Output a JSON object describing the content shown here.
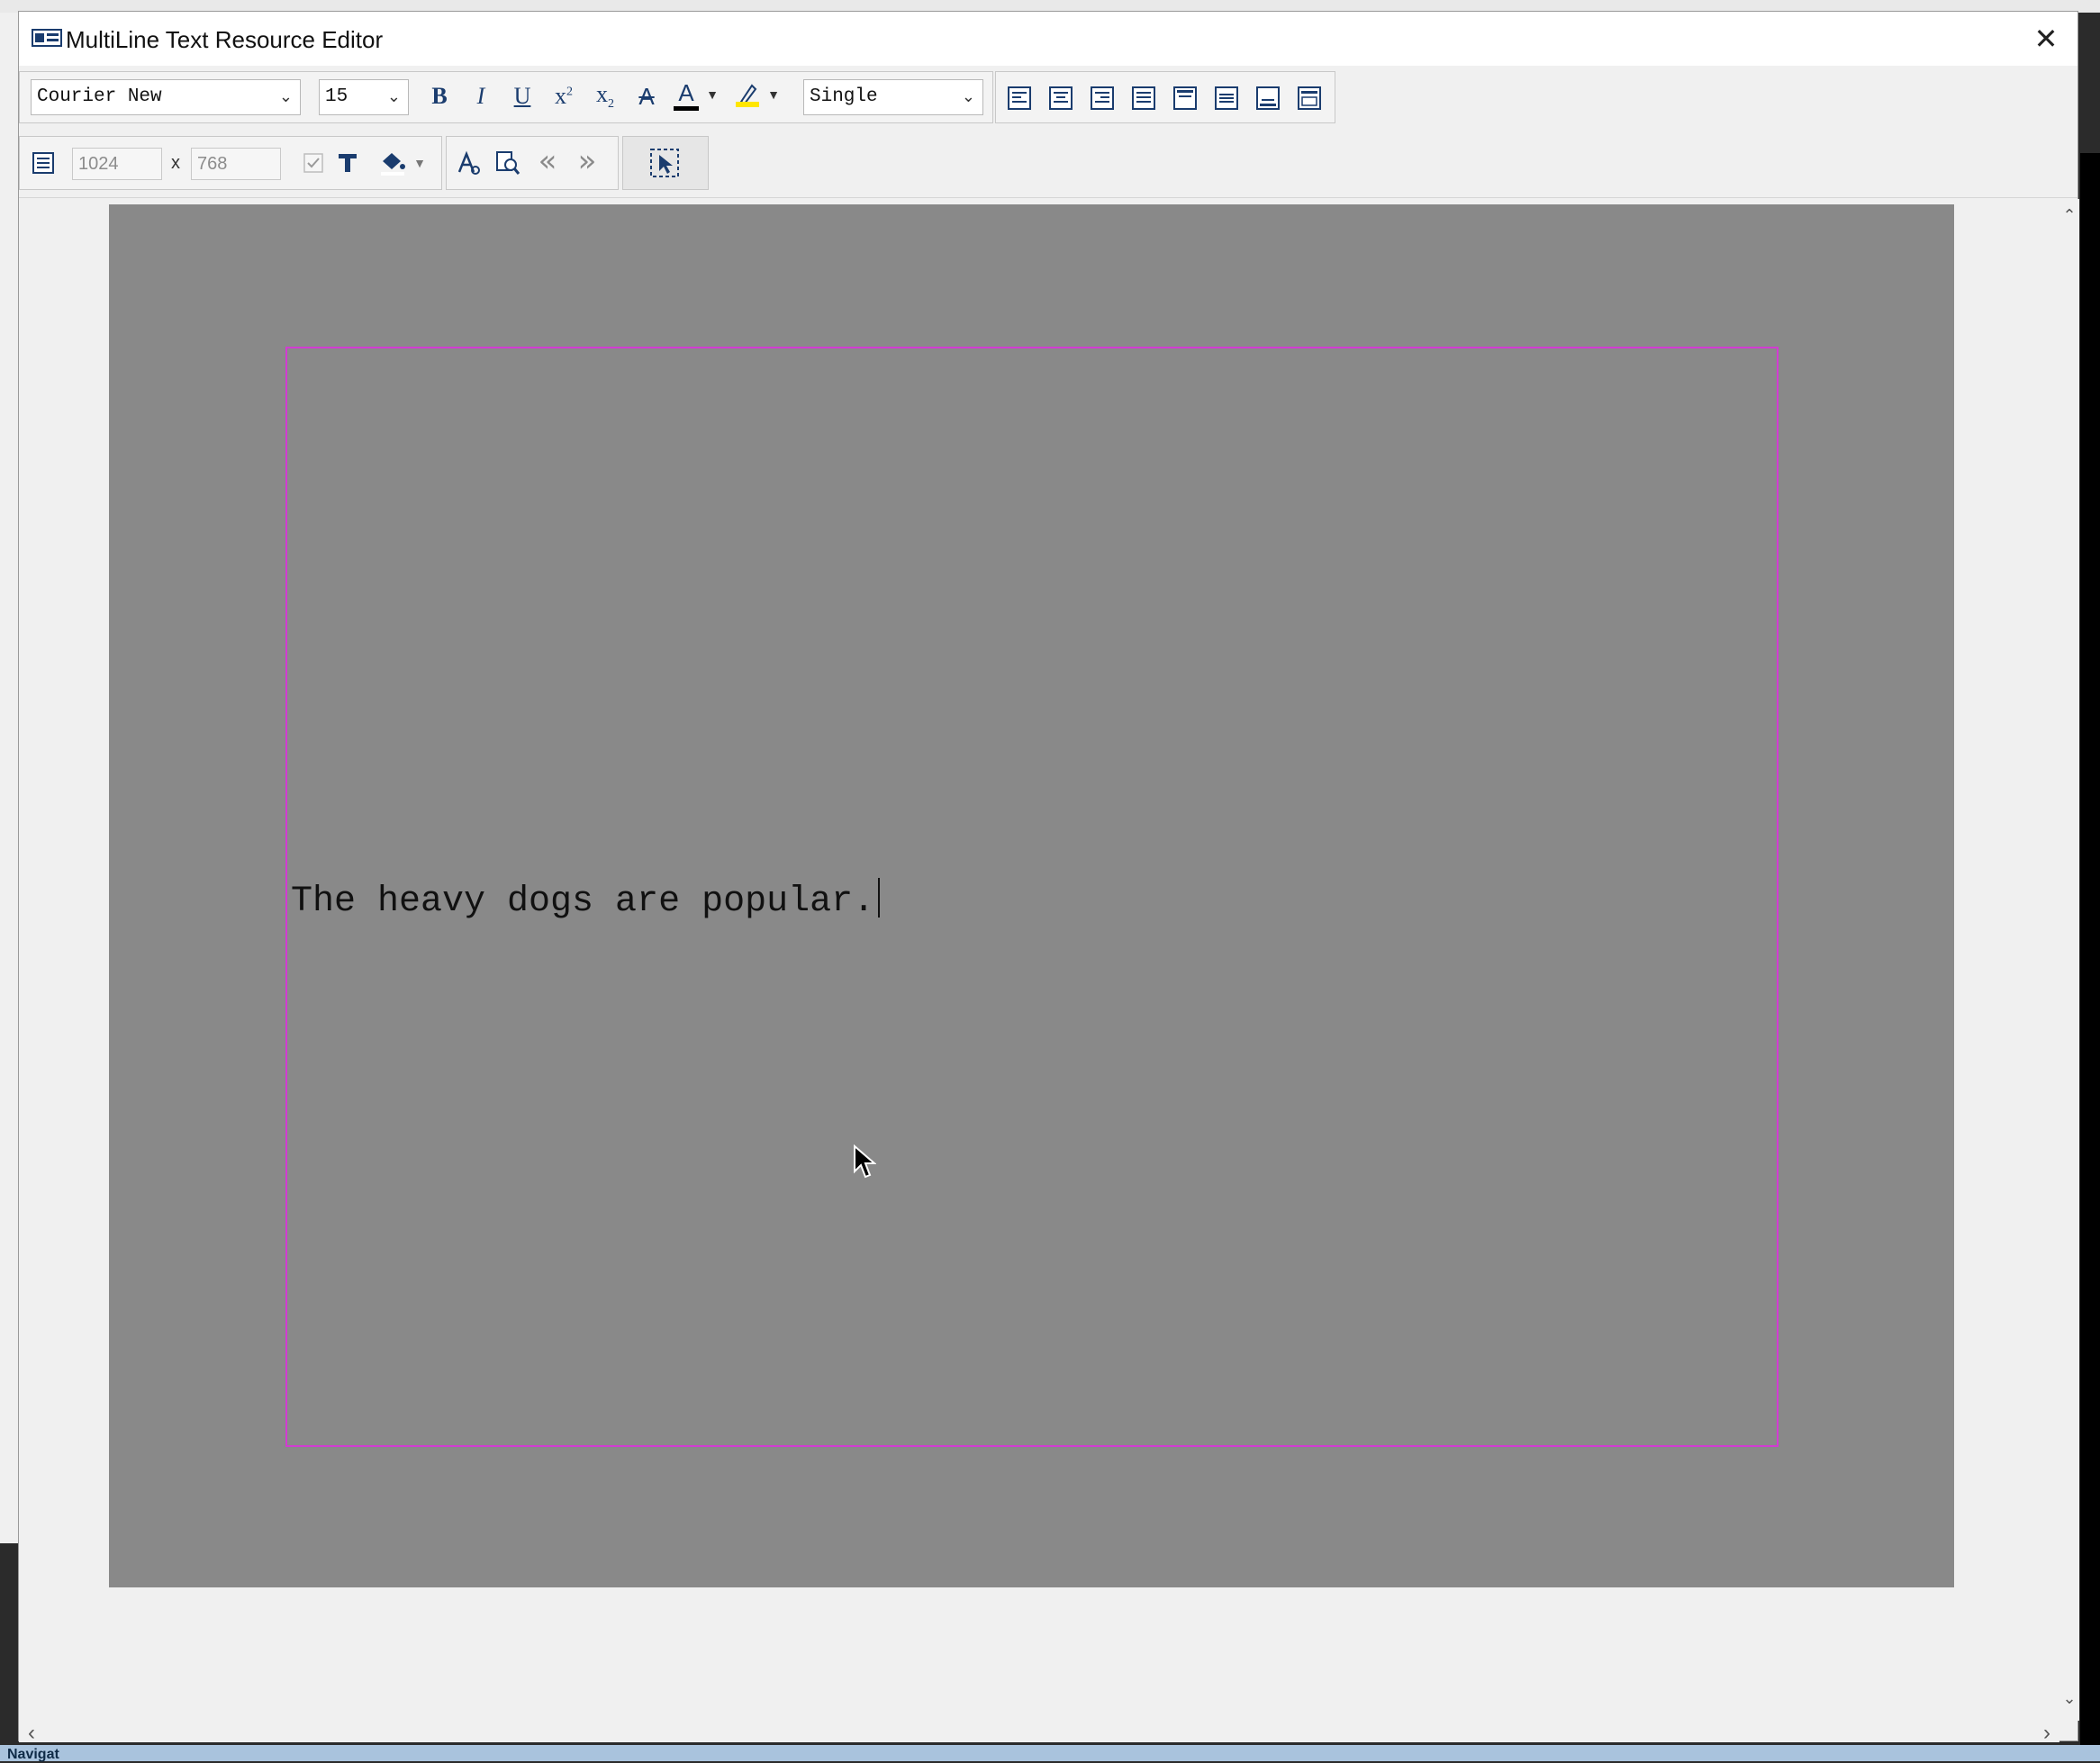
{
  "window": {
    "title": "MultiLine Text Resource Editor",
    "close_glyph": "✕"
  },
  "toolbar": {
    "font_family": "Courier New",
    "font_size": "15",
    "bold_label": "B",
    "italic_label": "I",
    "underline_label": "U",
    "superscript_label": "x",
    "superscript_mark": "2",
    "subscript_label": "x",
    "subscript_mark": "2",
    "strike_label": "A",
    "text_color_label": "A",
    "line_spacing": "Single",
    "width_value": "1024",
    "times_label": "x",
    "height_value": "768",
    "prev_glyph": "«",
    "next_glyph": "»"
  },
  "document": {
    "text": "The heavy dogs are popular."
  },
  "scroll": {
    "up": "⌃",
    "down": "⌄",
    "left": "‹",
    "right": "›"
  },
  "background_app": {
    "status_fragment": "Navigat"
  },
  "colors": {
    "frame_border": "#d23bd2",
    "stage": "#898989",
    "highlight": "#ffe600",
    "icon_blue": "#1a3c6e"
  },
  "icons": [
    "app-icon",
    "bold-icon",
    "italic-icon",
    "underline-icon",
    "superscript-icon",
    "subscript-icon",
    "strikethrough-icon",
    "text-color-icon",
    "highlight-icon",
    "align-left-icon",
    "align-center-icon",
    "align-right-icon",
    "justify-icon",
    "align-top-icon",
    "align-middle-icon",
    "align-bottom-icon",
    "rtl-icon",
    "page-size-icon",
    "checkbox-icon",
    "text-tool-icon",
    "fill-icon",
    "font-icon",
    "find-icon",
    "prev-icon",
    "next-icon",
    "select-tool-icon",
    "mouse-cursor-icon"
  ]
}
